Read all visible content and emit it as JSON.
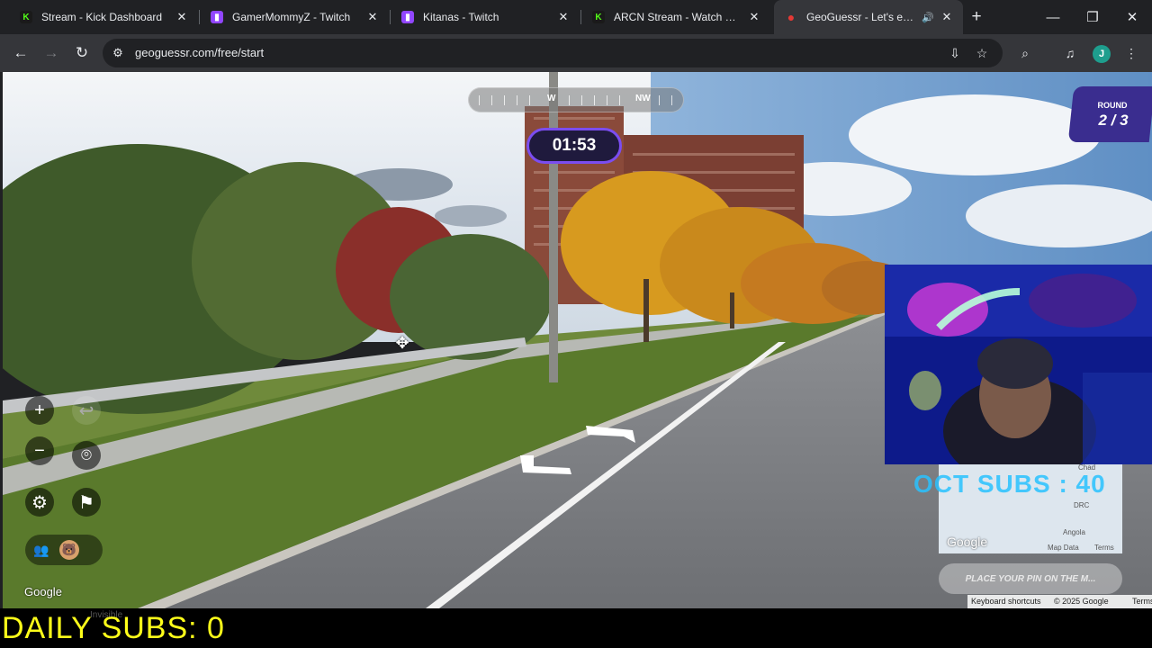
{
  "browser": {
    "tabs": [
      {
        "favicon": "kick-icon",
        "title": "Stream - Kick Dashboard",
        "active": false
      },
      {
        "favicon": "twitch-icon",
        "title": "GamerMommyZ - Twitch",
        "active": false
      },
      {
        "favicon": "twitch-icon",
        "title": "Kitanas - Twitch",
        "active": false
      },
      {
        "favicon": "kick-icon",
        "title": "ARCN Stream - Watch Live on Kick",
        "active": false
      },
      {
        "favicon": "geoguessr-icon",
        "title": "GeoGuessr - Let's explore the world!",
        "active": true,
        "audio": true
      }
    ],
    "address_bar": {
      "url": "geoguessr.com/free/start"
    },
    "profile_initial": "J",
    "icons": {
      "favicon_glyphs": {
        "kick": "K",
        "twitch": "▮",
        "geo": "●"
      },
      "close": "✕",
      "audio": "🔊",
      "new_tab": "+",
      "minimize": "—",
      "maximize": "❐",
      "back": "←",
      "forward": "→",
      "reload": "↻",
      "site_info": "⚙",
      "install": "⇩",
      "bookmark": "☆",
      "lens": "⌕",
      "media": "♫",
      "menu": "⋮"
    }
  },
  "game": {
    "compass": {
      "labels": [
        "W",
        "NW"
      ]
    },
    "timer": "01:53",
    "round": {
      "label": "ROUND",
      "value": "2 / 3"
    },
    "controls": {
      "zoom_in": "+",
      "zoom_out": "−",
      "undo": "↩",
      "checkpoint": "⌾",
      "settings": "⚙",
      "flag": "⚑",
      "party": "👥",
      "avatar": "🐻"
    },
    "cursor": "✥",
    "google_logo": "Google",
    "minimap": {
      "google_logo": "Google",
      "labels": [
        "Chad",
        "DRC",
        "Angola"
      ],
      "footer": [
        "Map Data",
        "Terms"
      ]
    },
    "place_pin_button": "PLACE YOUR PIN ON THE M...",
    "attribution": [
      "Keyboard shortcuts",
      "© 2025 Google",
      "Terms"
    ]
  },
  "stream_overlay": {
    "oct_subs": "OCT SUBS : 40",
    "daily_subs": "DAILY SUBS: 0",
    "ghost_status": "Invisible"
  }
}
